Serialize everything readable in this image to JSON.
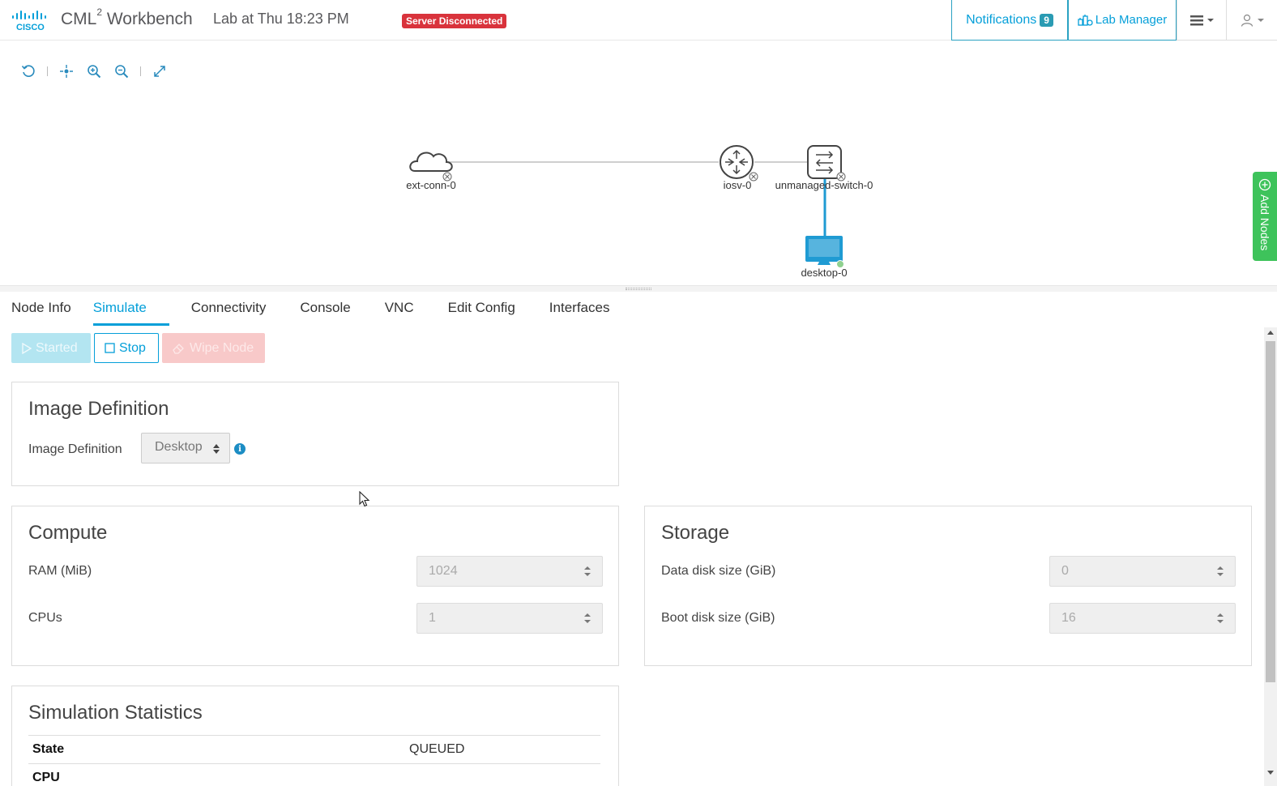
{
  "header": {
    "app_name": "CML",
    "app_sup": "2",
    "app_suffix": " Workbench",
    "lab_title": "Lab at Thu 18:23 PM",
    "server_status": "Server Disconnected",
    "notifications_label": "Notifications",
    "notifications_count": "9",
    "lab_manager_label": "Lab Manager",
    "status_color": "#d9333c",
    "accent_color": "#049fd9"
  },
  "toolbar": {
    "icons": [
      "refresh-icon",
      "center-icon",
      "zoom-in-icon",
      "zoom-out-icon",
      "fullscreen-icon"
    ]
  },
  "topology": {
    "nodes": [
      {
        "label": "ext-conn-0",
        "type": "cloud"
      },
      {
        "label": "iosv-0",
        "type": "router"
      },
      {
        "label": "unmanaged-switch-0",
        "type": "switch"
      },
      {
        "label": "desktop-0",
        "type": "desktop",
        "selected": true
      }
    ],
    "links": [
      {
        "from": "ext-conn-0",
        "to": "iosv-0"
      },
      {
        "from": "iosv-0",
        "to": "unmanaged-switch-0"
      },
      {
        "from": "unmanaged-switch-0",
        "to": "desktop-0",
        "highlighted": true
      }
    ],
    "highlight_color": "#1f9bd3"
  },
  "add_nodes_label": "Add Nodes",
  "tabs": [
    {
      "label": "Node Info",
      "active": false
    },
    {
      "label": "Simulate",
      "active": true
    },
    {
      "label": "Connectivity",
      "active": false
    },
    {
      "label": "Console",
      "active": false
    },
    {
      "label": "VNC",
      "active": false
    },
    {
      "label": "Edit Config",
      "active": false
    },
    {
      "label": "Interfaces",
      "active": false
    }
  ],
  "actions": {
    "started_label": "Started",
    "stop_label": "Stop",
    "wipe_label": "Wipe Node"
  },
  "image_definition": {
    "title": "Image Definition",
    "field_label": "Image Definition",
    "value": "Desktop"
  },
  "compute": {
    "title": "Compute",
    "ram_label": "RAM (MiB)",
    "ram_value": "1024",
    "cpus_label": "CPUs",
    "cpus_value": "1"
  },
  "storage": {
    "title": "Storage",
    "data_disk_label": "Data disk size (GiB)",
    "data_disk_value": "0",
    "boot_disk_label": "Boot disk size (GiB)",
    "boot_disk_value": "16"
  },
  "simulation_statistics": {
    "title": "Simulation Statistics",
    "rows": [
      {
        "key": "State",
        "value": "QUEUED"
      },
      {
        "key": "CPU",
        "value": ""
      }
    ]
  }
}
